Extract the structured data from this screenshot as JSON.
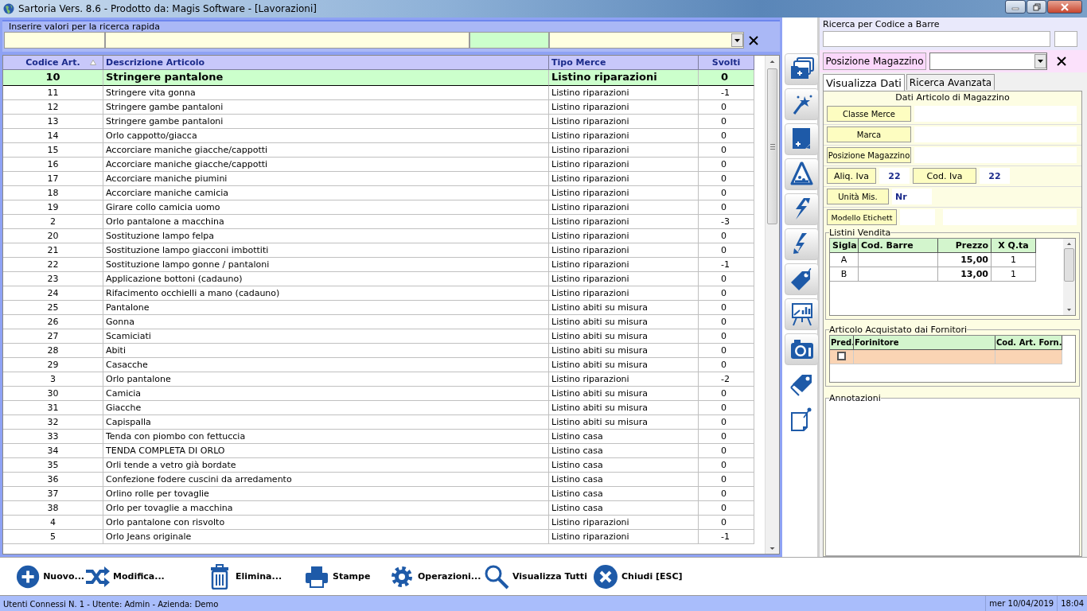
{
  "window": {
    "title": "Sartoria Vers. 8.6 - Prodotto da: Magis Software - [Lavorazioni]"
  },
  "quick_search": {
    "label": "Inserire valori per la ricerca rapida"
  },
  "table": {
    "columns": [
      {
        "label": "Codice Art.",
        "sorted": true
      },
      {
        "label": "Descrizione Articolo",
        "sorted": false
      },
      {
        "label": "Tipo Merce",
        "sorted": false
      },
      {
        "label": "Svolti",
        "sorted": false
      }
    ],
    "rows": [
      {
        "code": "10",
        "description": "Stringere pantalone",
        "type": "Listino riparazioni",
        "done": "0",
        "selected": true
      },
      {
        "code": "11",
        "description": "Stringere vita gonna",
        "type": "Listino riparazioni",
        "done": "-1",
        "selected": false
      },
      {
        "code": "12",
        "description": "Stringere gambe pantaloni",
        "type": "Listino riparazioni",
        "done": "0",
        "selected": false
      },
      {
        "code": "13",
        "description": "Stringere gambe pantaloni",
        "type": "Listino riparazioni",
        "done": "0",
        "selected": false
      },
      {
        "code": "14",
        "description": "Orlo cappotto/giacca",
        "type": "Listino riparazioni",
        "done": "0",
        "selected": false
      },
      {
        "code": "15",
        "description": "Accorciare maniche giacche/cappotti",
        "type": "Listino riparazioni",
        "done": "0",
        "selected": false
      },
      {
        "code": "16",
        "description": "Accorciare maniche giacche/cappotti",
        "type": "Listino riparazioni",
        "done": "0",
        "selected": false
      },
      {
        "code": "17",
        "description": "Accorciare maniche piumini",
        "type": "Listino riparazioni",
        "done": "0",
        "selected": false
      },
      {
        "code": "18",
        "description": "Accorciare maniche camicia",
        "type": "Listino riparazioni",
        "done": "0",
        "selected": false
      },
      {
        "code": "19",
        "description": "Girare collo camicia uomo",
        "type": "Listino riparazioni",
        "done": "0",
        "selected": false
      },
      {
        "code": "2",
        "description": "Orlo pantalone a macchina",
        "type": "Listino riparazioni",
        "done": "-3",
        "selected": false
      },
      {
        "code": "20",
        "description": "Sostituzione lampo felpa",
        "type": "Listino riparazioni",
        "done": "0",
        "selected": false
      },
      {
        "code": "21",
        "description": "Sostituzione lampo giacconi imbottiti",
        "type": "Listino riparazioni",
        "done": "0",
        "selected": false
      },
      {
        "code": "22",
        "description": "Sostituzione lampo gonne / pantaloni",
        "type": "Listino riparazioni",
        "done": "-1",
        "selected": false
      },
      {
        "code": "23",
        "description": "Applicazione bottoni (cadauno)",
        "type": "Listino riparazioni",
        "done": "0",
        "selected": false
      },
      {
        "code": "24",
        "description": "Rifacimento occhielli a mano (cadauno)",
        "type": "Listino riparazioni",
        "done": "0",
        "selected": false
      },
      {
        "code": "25",
        "description": "Pantalone",
        "type": "Listino abiti su misura",
        "done": "0",
        "selected": false
      },
      {
        "code": "26",
        "description": "Gonna",
        "type": "Listino abiti su misura",
        "done": "0",
        "selected": false
      },
      {
        "code": "27",
        "description": "Scamiciati",
        "type": "Listino abiti su misura",
        "done": "0",
        "selected": false
      },
      {
        "code": "28",
        "description": "Abiti",
        "type": "Listino abiti su misura",
        "done": "0",
        "selected": false
      },
      {
        "code": "29",
        "description": "Casacche",
        "type": "Listino abiti su misura",
        "done": "0",
        "selected": false
      },
      {
        "code": "3",
        "description": "Orlo pantalone",
        "type": "Listino riparazioni",
        "done": "-2",
        "selected": false
      },
      {
        "code": "30",
        "description": "Camicia",
        "type": "Listino abiti su misura",
        "done": "0",
        "selected": false
      },
      {
        "code": "31",
        "description": "Giacche",
        "type": "Listino abiti su misura",
        "done": "0",
        "selected": false
      },
      {
        "code": "32",
        "description": "Capispalla",
        "type": "Listino abiti su misura",
        "done": "0",
        "selected": false
      },
      {
        "code": "33",
        "description": "Tenda con piombo con fettuccia",
        "type": "Listino casa",
        "done": "0",
        "selected": false
      },
      {
        "code": "34",
        "description": "TENDA COMPLETA DI ORLO",
        "type": "Listino casa",
        "done": "0",
        "selected": false
      },
      {
        "code": "35",
        "description": "Orli tende a vetro già bordate",
        "type": "Listino casa",
        "done": "0",
        "selected": false
      },
      {
        "code": "36",
        "description": "Confezione fodere cuscini da arredamento",
        "type": "Listino casa",
        "done": "0",
        "selected": false
      },
      {
        "code": "37",
        "description": "Orlino rolle per tovaglie",
        "type": "Listino casa",
        "done": "0",
        "selected": false
      },
      {
        "code": "38",
        "description": "Orlo per tovaglie a macchina",
        "type": "Listino casa",
        "done": "0",
        "selected": false
      },
      {
        "code": "4",
        "description": "Orlo pantalone con risvolto",
        "type": "Listino riparazioni",
        "done": "0",
        "selected": false
      },
      {
        "code": "5",
        "description": "Orlo Jeans originale",
        "type": "Listino riparazioni",
        "done": "-1",
        "selected": false
      }
    ]
  },
  "barcode_search": {
    "label": "Ricerca per Codice a Barre"
  },
  "warehouse_filter": {
    "label": "Posizione Magazzino"
  },
  "tabs": [
    {
      "label": "Visualizza Dati",
      "selected": true
    },
    {
      "label": "Ricerca Avanzata",
      "selected": false
    }
  ],
  "details": {
    "title": "Dati Articolo di Magazzino",
    "fields": [
      {
        "label": "Classe Merce"
      },
      {
        "label": "Marca"
      },
      {
        "label": "Posizione Magazzino"
      }
    ],
    "vat_rate": {
      "label": "Aliq. Iva",
      "value": "22"
    },
    "vat_code": {
      "label": "Cod. Iva",
      "value": "22"
    },
    "unit": {
      "label": "Unità Mis.",
      "value": "Nr"
    },
    "label_model": {
      "label": "Modello Etichett"
    }
  },
  "price_lists": {
    "title": "Listini Vendita",
    "columns": [
      "Sigla",
      "Cod. Barre",
      "Prezzo",
      "X Q.ta"
    ],
    "rows": [
      {
        "code": "A",
        "price": "15,00",
        "quantity": "1"
      },
      {
        "code": "B",
        "price": "13,00",
        "quantity": "1"
      }
    ]
  },
  "suppliers": {
    "title": "Articolo Acquistato dai Fornitori",
    "columns": [
      "Pred.",
      "Forinitore",
      "Cod. Art. Forn."
    ],
    "rows": [
      {
        "preferred": false
      }
    ]
  },
  "notes": {
    "title": "Annotazioni"
  },
  "actions": [
    {
      "label": "Nuovo...",
      "kind": "plus"
    },
    {
      "label": "Modifica...",
      "kind": "shuffle"
    },
    {
      "label": "Elimina...",
      "kind": "trash"
    },
    {
      "label": "Stampe",
      "kind": "printer"
    },
    {
      "label": "Operazioni...",
      "kind": "gear"
    },
    {
      "label": "Visualizza Tutti",
      "kind": "search"
    },
    {
      "label": "Chiudi [ESC]",
      "kind": "close"
    }
  ],
  "status_bar": {
    "info": "Utenti Connessi N. 1 - Utente: Admin - Azienda: Demo",
    "date": "mer 10/04/2019",
    "time": "18:04"
  }
}
